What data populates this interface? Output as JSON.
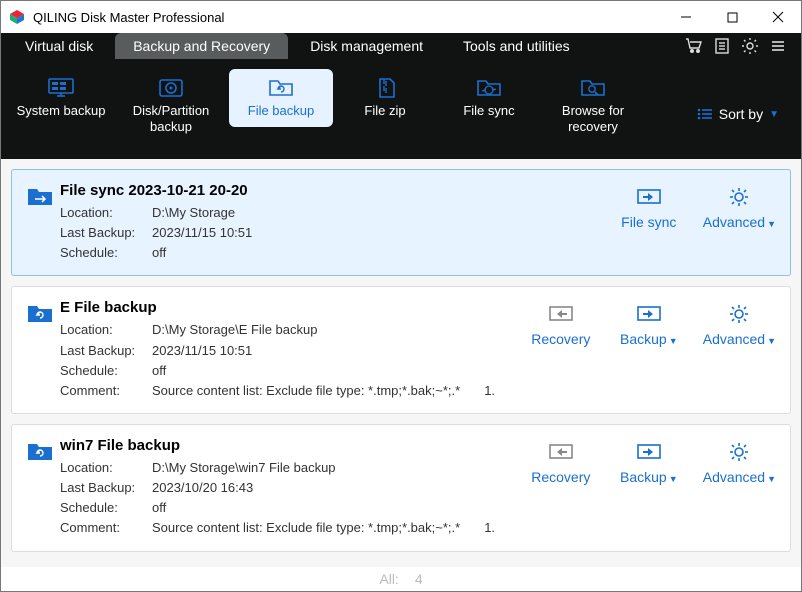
{
  "window": {
    "title": "QILING Disk Master Professional"
  },
  "main_tabs": {
    "virtual": "Virtual disk",
    "backup": "Backup and Recovery",
    "disk": "Disk management",
    "tools": "Tools and utilities"
  },
  "toolbar": {
    "system_backup": "System backup",
    "disk_partition_backup": "Disk/Partition backup",
    "file_backup": "File backup",
    "file_zip": "File zip",
    "file_sync": "File sync",
    "browse_recovery": "Browse for recovery",
    "sort_by": "Sort by"
  },
  "labels": {
    "location": "Location:",
    "last_backup": "Last Backup:",
    "schedule": "Schedule:",
    "comment": "Comment:"
  },
  "actions": {
    "file_sync": "File sync",
    "advanced": "Advanced",
    "recovery": "Recovery",
    "backup": "Backup"
  },
  "jobs": [
    {
      "title": "File sync 2023-10-21 20-20",
      "location": "D:\\My Storage",
      "last_backup": "2023/11/15 10:51",
      "schedule": "off"
    },
    {
      "title": "E  File backup",
      "location": "D:\\My Storage\\E  File backup",
      "last_backup": "2023/11/15 10:51",
      "schedule": "off",
      "comment": "Source content list:  Exclude file type: *.tmp;*.bak;~*;.*",
      "comment_n": "1."
    },
    {
      "title": "win7 File backup",
      "location": "D:\\My Storage\\win7 File backup",
      "last_backup": "2023/10/20 16:43",
      "schedule": "off",
      "comment": "Source content list:  Exclude file type: *.tmp;*.bak;~*;.*",
      "comment_n": "1."
    }
  ],
  "footer": {
    "all": "All:",
    "count": "4"
  },
  "colors": {
    "accent": "#1a6fcf",
    "dark": "#111212",
    "card_sel_bg": "#e7f3ff",
    "card_sel_border": "#8cc0ef"
  }
}
